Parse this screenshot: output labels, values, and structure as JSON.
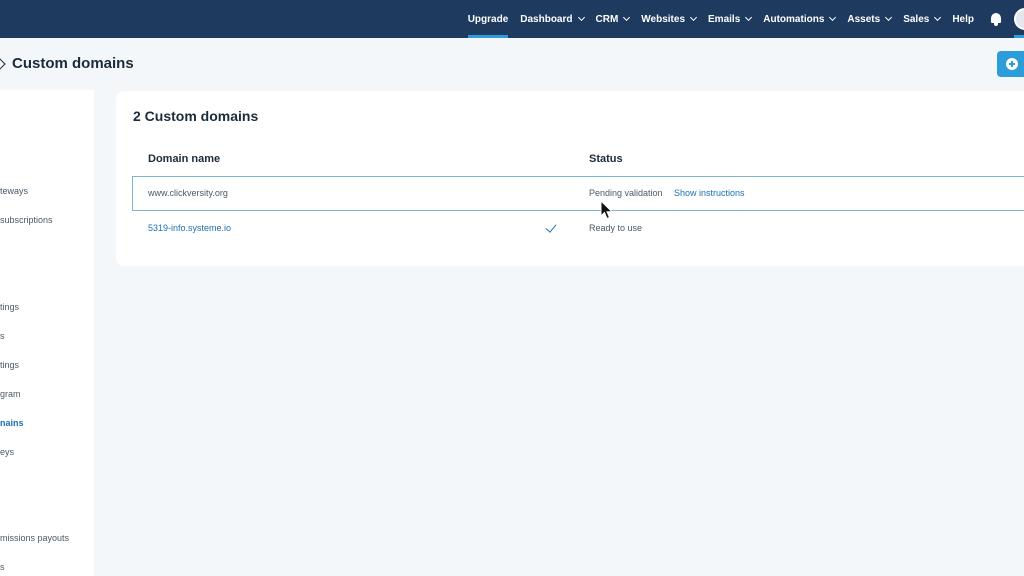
{
  "nav": {
    "upgrade": "Upgrade",
    "dashboard": "Dashboard",
    "crm": "CRM",
    "websites": "Websites",
    "emails": "Emails",
    "automations": "Automations",
    "assets": "Assets",
    "sales": "Sales",
    "help": "Help",
    "bell_icon": "bell-icon"
  },
  "header": {
    "title": "Custom domains",
    "back_icon": "chevron-left-icon",
    "add_icon": "plus-circle-icon"
  },
  "sidebar": {
    "items": [
      {
        "label": "teways"
      },
      {
        "label": "subscriptions"
      },
      {
        "label": "tings"
      },
      {
        "label": "s"
      },
      {
        "label": "tings"
      },
      {
        "label": "gram"
      },
      {
        "label": "nains"
      },
      {
        "label": "eys"
      },
      {
        "label": "missions payouts"
      },
      {
        "label": "s"
      }
    ],
    "active_index": 6
  },
  "main": {
    "card_title": "2 Custom domains",
    "columns": [
      "Domain name",
      "Status"
    ],
    "rows": [
      {
        "domain": "www.clickversity.org",
        "status": "Pending validation",
        "action": "Show instructions"
      },
      {
        "domain": "5319-info.systeme.io",
        "status": "Ready to use",
        "verified_icon": "checkmark-icon"
      }
    ]
  },
  "colors": {
    "nav_bg": "#1e3a5f",
    "accent": "#2d9cdb",
    "link": "#1e6fb0",
    "page_bg": "#f4f7fa"
  }
}
